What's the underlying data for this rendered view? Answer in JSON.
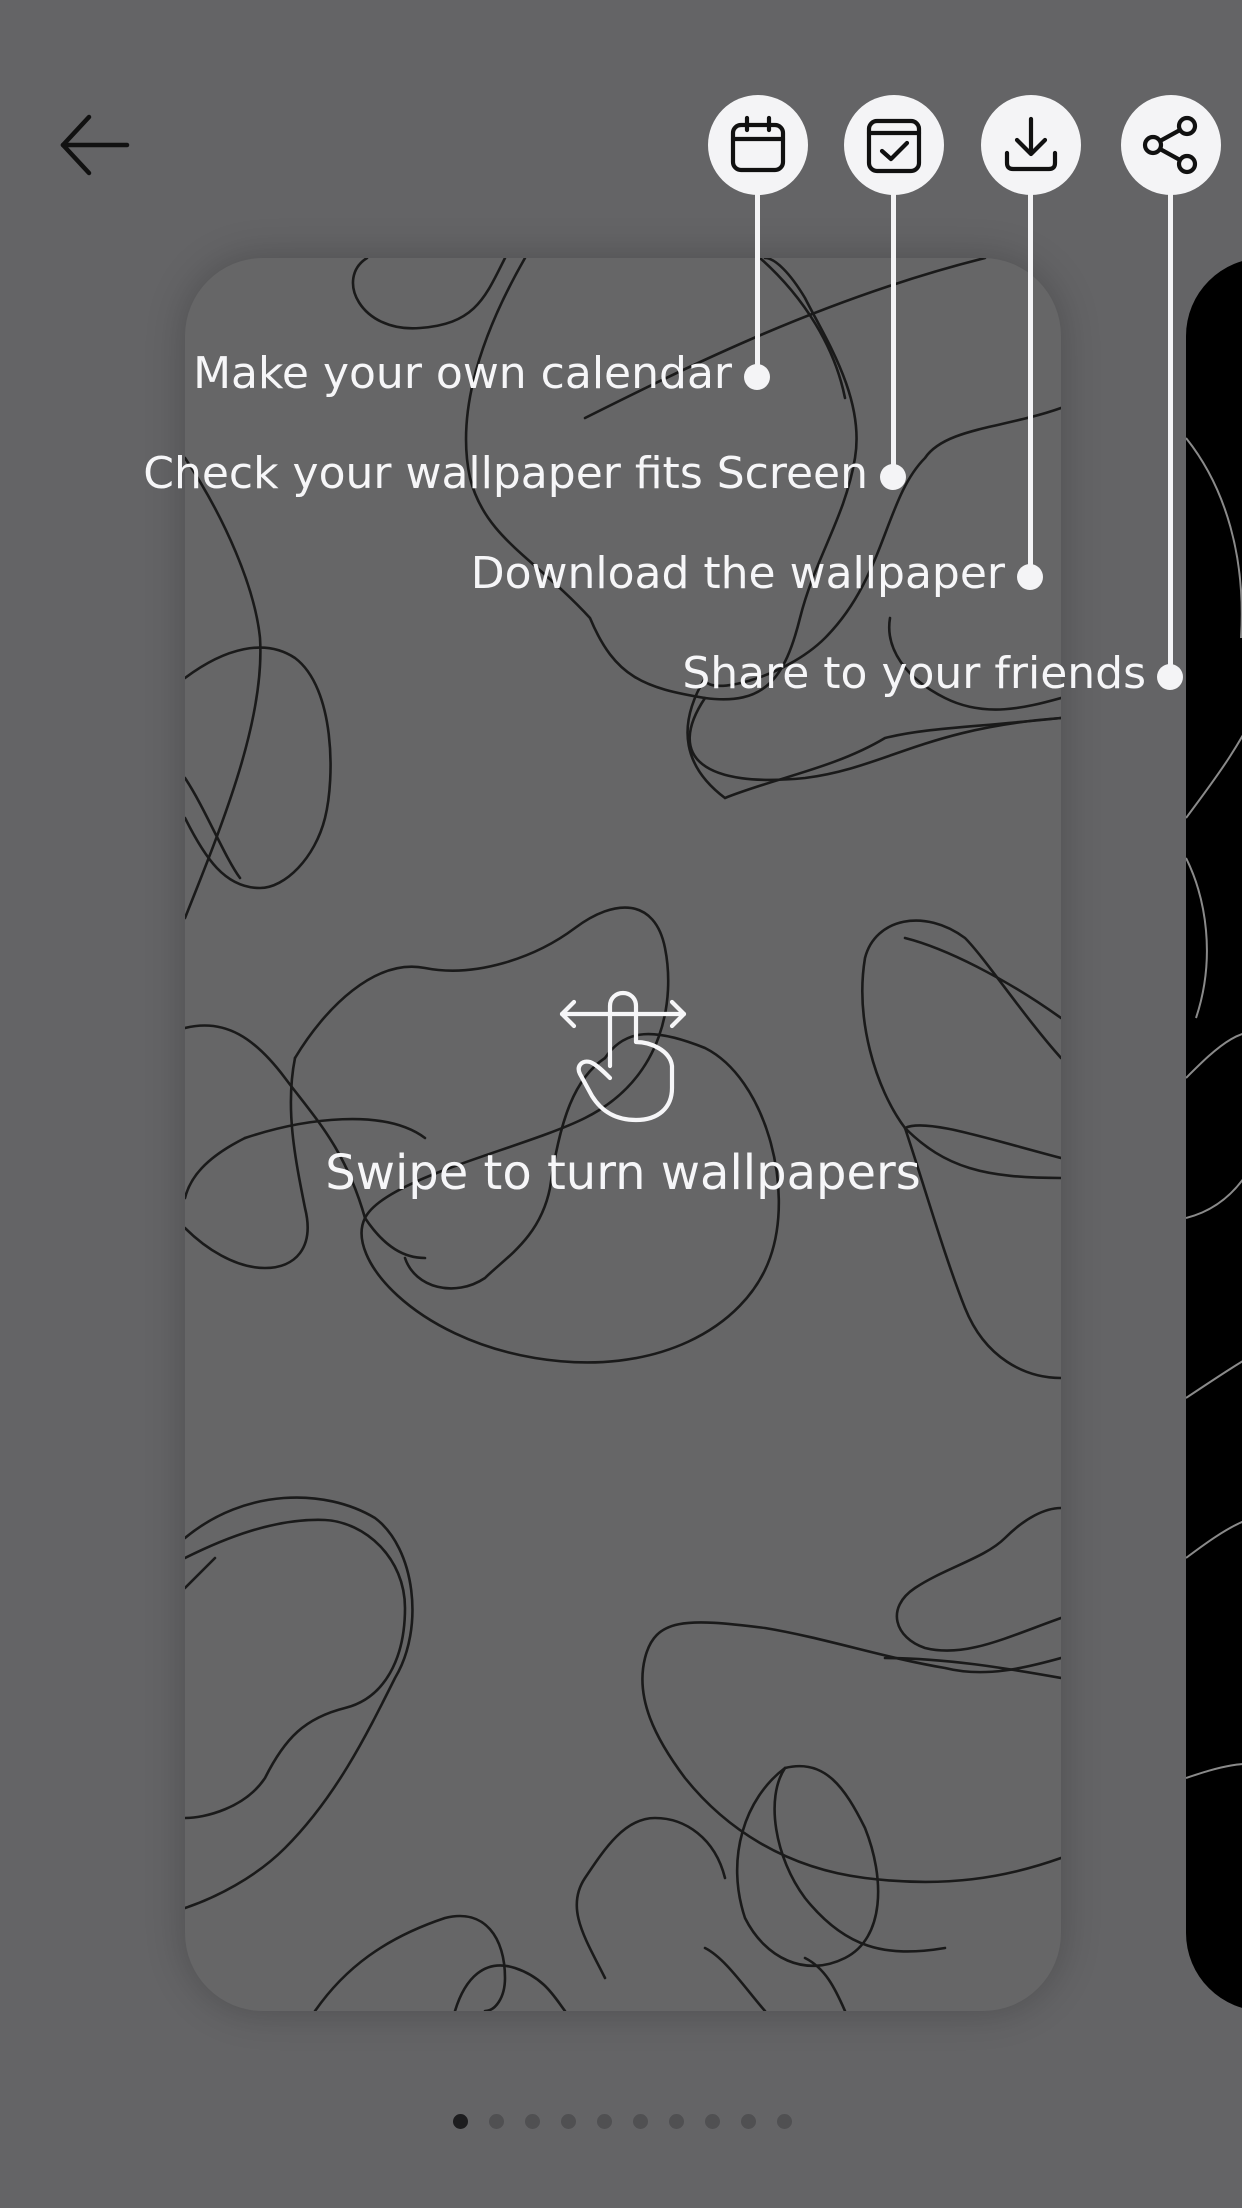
{
  "hints": {
    "calendar": "Make your own calendar",
    "fit": "Check your wallpaper fits Screen",
    "download": "Download the wallpaper",
    "share": "Share to your friends",
    "swipe": "Swipe to turn wallpapers"
  },
  "toolbar": {
    "back_icon": "arrow-left-icon",
    "calendar_icon": "calendar-icon",
    "fit_icon": "calendar-check-icon",
    "download_icon": "download-icon",
    "share_icon": "share-icon"
  },
  "swipe_icon": "swipe-hand-icon",
  "pager": {
    "total": 10,
    "current": 1
  },
  "colors": {
    "background": "#646466",
    "card": "#666667",
    "overlay_white": "#f4f4f6",
    "pattern_stroke": "#1a1a1a"
  }
}
